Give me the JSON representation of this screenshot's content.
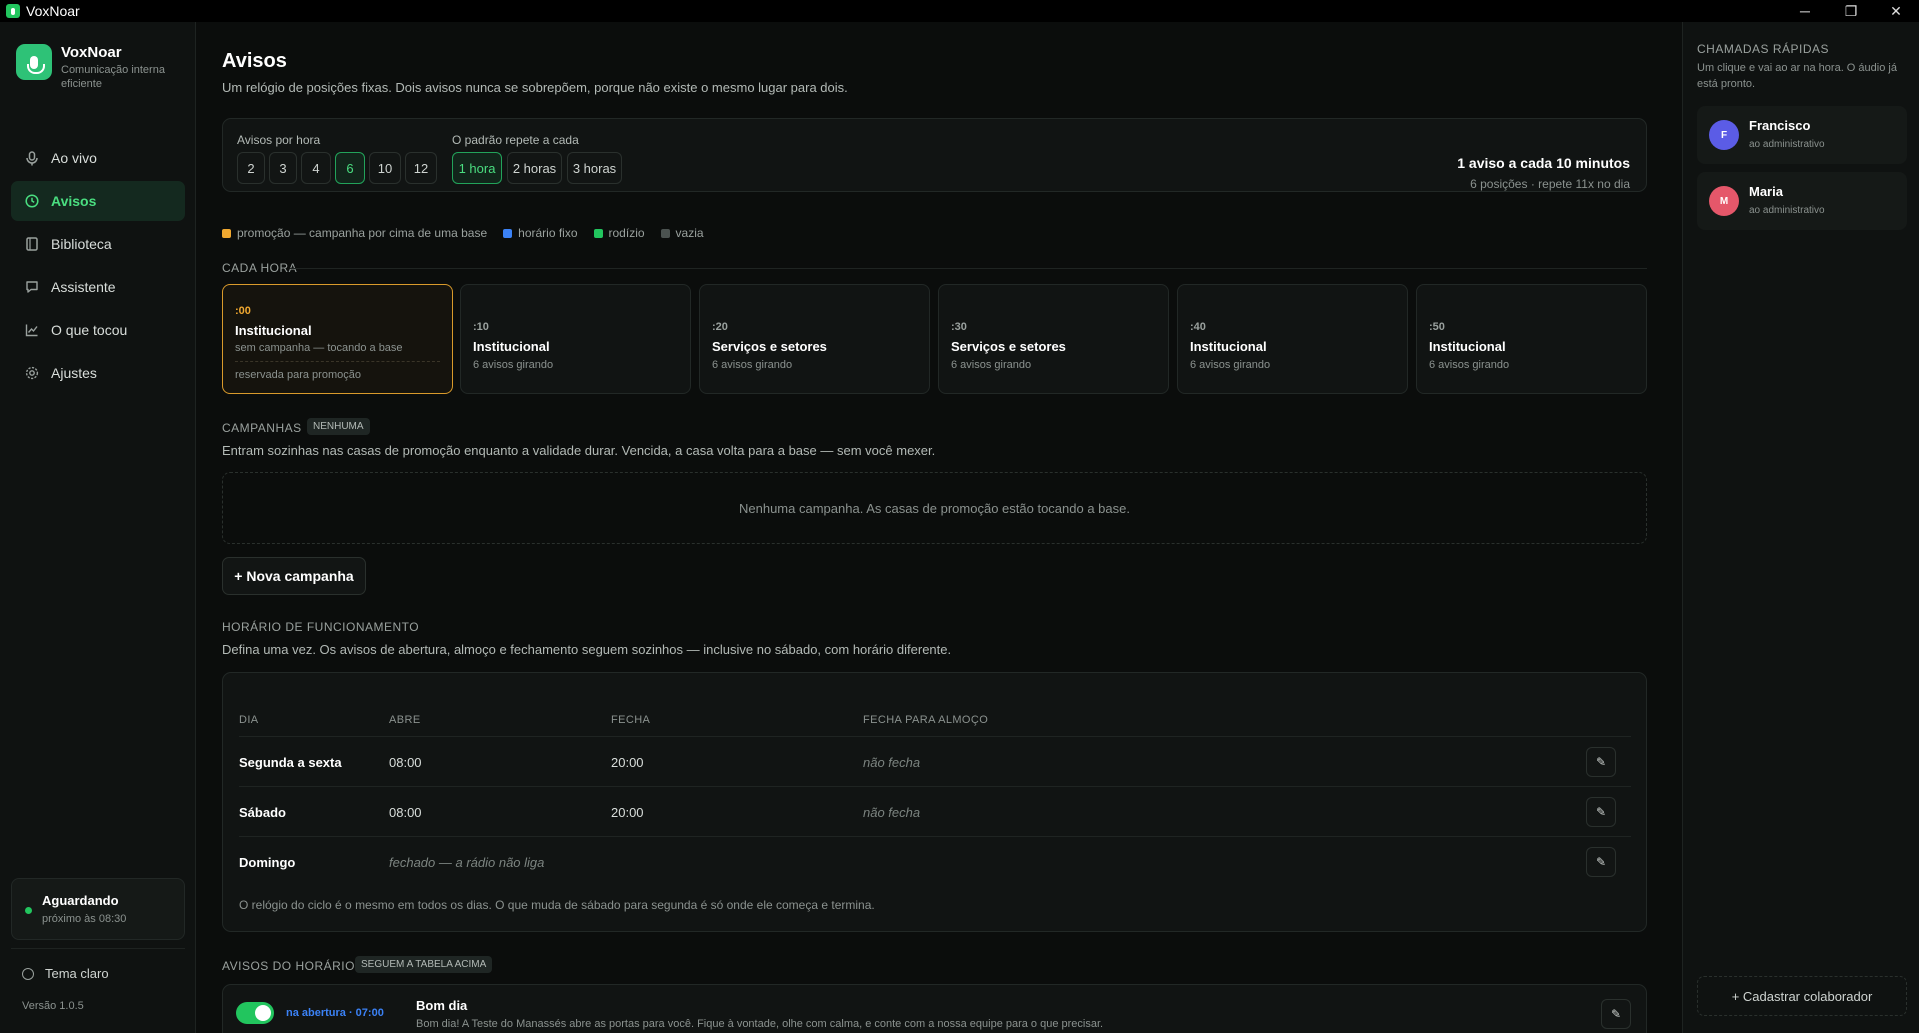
{
  "window": {
    "title": "VoxNoar",
    "minimize": "─",
    "restore": "❐",
    "close": "✕"
  },
  "sidebar": {
    "brand_name": "VoxNoar",
    "brand_sub": "Comunicação interna eficiente",
    "items": [
      {
        "label": "Ao vivo",
        "icon": "mic-icon",
        "glyph": "🎙"
      },
      {
        "label": "Avisos",
        "icon": "clock-icon",
        "glyph": "◷",
        "active": true
      },
      {
        "label": "Biblioteca",
        "icon": "book-icon",
        "glyph": "▯"
      },
      {
        "label": "Assistente",
        "icon": "chat-icon",
        "glyph": "▢"
      },
      {
        "label": "O que tocou",
        "icon": "chart-icon",
        "glyph": "↗"
      },
      {
        "label": "Ajustes",
        "icon": "gear-icon",
        "glyph": "⚙"
      }
    ],
    "status_title": "Aguardando",
    "status_sub": "próximo às 08:30",
    "theme_label": "Tema claro",
    "version": "Versão 1.0.5"
  },
  "main": {
    "title": "Avisos",
    "subtitle": "Um relógio de posições fixas. Dois avisos nunca se sobrepõem, porque não existe o mesmo lugar para dois.",
    "per_hour_label": "Avisos por hora",
    "per_hour_options": [
      "2",
      "3",
      "4",
      "6",
      "10",
      "12"
    ],
    "per_hour_selected": "6",
    "repeat_label": "O padrão repete a cada",
    "repeat_options": [
      "1 hora",
      "2 horas",
      "3 horas"
    ],
    "repeat_selected": "1 hora",
    "summary_title": "1 aviso a cada 10 minutos",
    "summary_sub": "6 posições · repete 11x no dia",
    "legend": [
      {
        "label": "promoção — campanha por cima de uma base",
        "color": "#f0a830"
      },
      {
        "label": "horário fixo",
        "color": "#3b82f6"
      },
      {
        "label": "rodízio",
        "color": "#22c55e"
      },
      {
        "label": "vazia",
        "color": "#4b5250"
      }
    ],
    "each_hour_heading": "CADA HORA",
    "slots": [
      {
        "minute": ":00",
        "name": "Institucional",
        "sub": "sem campanha — tocando a base",
        "reserved": "reservada para promoção"
      },
      {
        "minute": ":10",
        "name": "Institucional",
        "sub": "6 avisos girando"
      },
      {
        "minute": ":20",
        "name": "Serviços e setores",
        "sub": "6 avisos girando"
      },
      {
        "minute": ":30",
        "name": "Serviços e setores",
        "sub": "6 avisos girando"
      },
      {
        "minute": ":40",
        "name": "Institucional",
        "sub": "6 avisos girando"
      },
      {
        "minute": ":50",
        "name": "Institucional",
        "sub": "6 avisos girando"
      }
    ],
    "campaigns_heading": "CAMPANHAS",
    "campaigns_badge": "NENHUMA",
    "campaigns_desc": "Entram sozinhas nas casas de promoção enquanto a validade durar. Vencida, a casa volta para a base — sem você mexer.",
    "campaigns_empty": "Nenhuma campanha. As casas de promoção estão tocando a base.",
    "new_campaign": "+ Nova campanha",
    "hours_heading": "HORÁRIO DE FUNCIONAMENTO",
    "hours_desc": "Defina uma vez. Os avisos de abertura, almoço e fechamento seguem sozinhos — inclusive no sábado, com horário diferente.",
    "hours_table": {
      "headers": [
        "DIA",
        "ABRE",
        "FECHA",
        "FECHA PARA ALMOÇO"
      ],
      "rows": [
        {
          "day": "Segunda a sexta",
          "open": "08:00",
          "close": "20:00",
          "lunch": "não fecha"
        },
        {
          "day": "Sábado",
          "open": "08:00",
          "close": "20:00",
          "lunch": "não fecha"
        },
        {
          "day": "Domingo",
          "closed": "fechado — a rádio não liga"
        }
      ],
      "edit_glyph": "✎",
      "note": "O relógio do ciclo é o mesmo em todos os dias. O que muda de sábado para segunda é só onde ele começa e termina."
    },
    "schedule_heading": "AVISOS DO HORÁRIO",
    "schedule_badge": "SEGUEM A TABELA ACIMA",
    "announcement": {
      "when": "na abertura · 07:00",
      "title": "Bom dia",
      "text": "Bom dia! A Teste do Manassés abre as portas para você. Fique à vontade, olhe com calma, e conte com a nossa equipe para o que precisar."
    }
  },
  "right_panel": {
    "heading": "CHAMADAS RÁPIDAS",
    "sub": "Um clique e vai ao ar na hora. O áudio já está pronto.",
    "contacts": [
      {
        "initial": "F",
        "name": "Francisco",
        "sub": "ao administrativo",
        "color": "#5b5ce6"
      },
      {
        "initial": "M",
        "name": "Maria",
        "sub": "ao administrativo",
        "color": "#e5576a"
      }
    ],
    "add_button": "+ Cadastrar colaborador"
  }
}
